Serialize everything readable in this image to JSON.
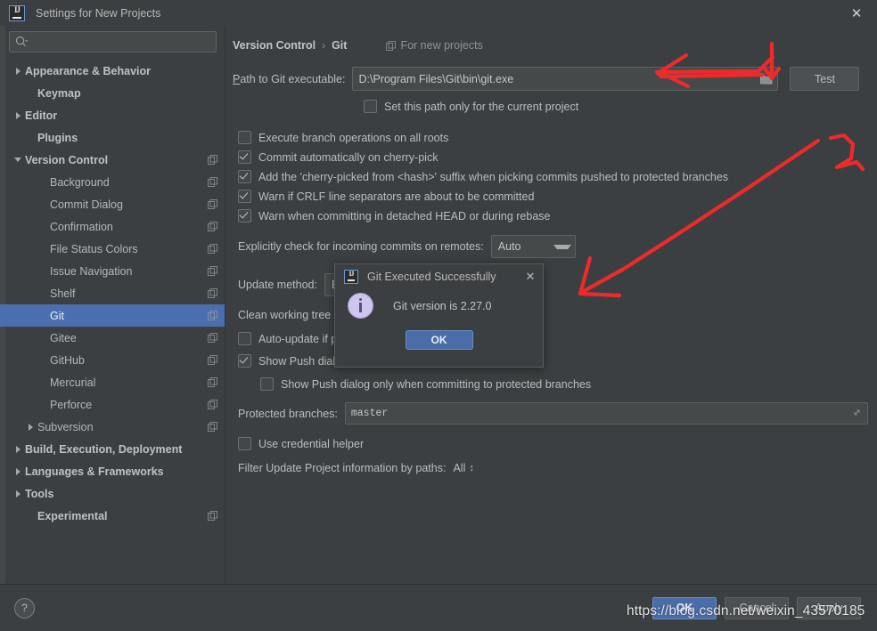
{
  "window": {
    "title": "Settings for New Projects",
    "close_label": "✕",
    "logo_name": "intellij-idea-logo"
  },
  "sidebar": {
    "search": {
      "value": "",
      "placeholder": ""
    },
    "items": [
      {
        "label": "Appearance & Behavior",
        "indent": 0,
        "twisty": "right",
        "bold": true,
        "copy": false,
        "selected": false
      },
      {
        "label": "Keymap",
        "indent": 1,
        "twisty": "none",
        "bold": true,
        "copy": false,
        "selected": false
      },
      {
        "label": "Editor",
        "indent": 0,
        "twisty": "right",
        "bold": true,
        "copy": false,
        "selected": false
      },
      {
        "label": "Plugins",
        "indent": 1,
        "twisty": "none",
        "bold": true,
        "copy": false,
        "selected": false
      },
      {
        "label": "Version Control",
        "indent": 0,
        "twisty": "down",
        "bold": true,
        "copy": true,
        "selected": false
      },
      {
        "label": "Background",
        "indent": 2,
        "twisty": "none",
        "bold": false,
        "copy": true,
        "selected": false
      },
      {
        "label": "Commit Dialog",
        "indent": 2,
        "twisty": "none",
        "bold": false,
        "copy": true,
        "selected": false
      },
      {
        "label": "Confirmation",
        "indent": 2,
        "twisty": "none",
        "bold": false,
        "copy": true,
        "selected": false
      },
      {
        "label": "File Status Colors",
        "indent": 2,
        "twisty": "none",
        "bold": false,
        "copy": true,
        "selected": false
      },
      {
        "label": "Issue Navigation",
        "indent": 2,
        "twisty": "none",
        "bold": false,
        "copy": true,
        "selected": false
      },
      {
        "label": "Shelf",
        "indent": 2,
        "twisty": "none",
        "bold": false,
        "copy": true,
        "selected": false
      },
      {
        "label": "Git",
        "indent": 2,
        "twisty": "none",
        "bold": false,
        "copy": true,
        "selected": true
      },
      {
        "label": "Gitee",
        "indent": 2,
        "twisty": "none",
        "bold": false,
        "copy": true,
        "selected": false
      },
      {
        "label": "GitHub",
        "indent": 2,
        "twisty": "none",
        "bold": false,
        "copy": true,
        "selected": false
      },
      {
        "label": "Mercurial",
        "indent": 2,
        "twisty": "none",
        "bold": false,
        "copy": true,
        "selected": false
      },
      {
        "label": "Perforce",
        "indent": 2,
        "twisty": "none",
        "bold": false,
        "copy": true,
        "selected": false
      },
      {
        "label": "Subversion",
        "indent": 1,
        "twisty": "right",
        "bold": false,
        "copy": true,
        "selected": false
      },
      {
        "label": "Build, Execution, Deployment",
        "indent": 0,
        "twisty": "right",
        "bold": true,
        "copy": false,
        "selected": false
      },
      {
        "label": "Languages & Frameworks",
        "indent": 0,
        "twisty": "right",
        "bold": true,
        "copy": false,
        "selected": false
      },
      {
        "label": "Tools",
        "indent": 0,
        "twisty": "right",
        "bold": true,
        "copy": false,
        "selected": false
      },
      {
        "label": "Experimental",
        "indent": 1,
        "twisty": "none",
        "bold": true,
        "copy": true,
        "selected": false
      }
    ]
  },
  "main": {
    "breadcrumb": {
      "parent": "Version Control",
      "separator": "›",
      "current": "Git"
    },
    "for_new_projects": "For new projects",
    "path_row": {
      "label": "Path to Git executable:",
      "value": "D:\\Program Files\\Git\\bin\\git.exe",
      "browse_icon": "folder-open-icon",
      "test_button": "Test"
    },
    "set_path_current_project": {
      "label": "Set this path only for the current project",
      "checked": false
    },
    "options": [
      {
        "label": "Execute branch operations on all roots",
        "checked": false
      },
      {
        "label": "Commit automatically on cherry-pick",
        "checked": true
      },
      {
        "label": "Add the 'cherry-picked from <hash>' suffix when picking commits pushed to protected branches",
        "checked": true
      },
      {
        "label": "Warn if CRLF line separators are about to be committed",
        "checked": true
      },
      {
        "label": "Warn when committing in detached HEAD or during rebase",
        "checked": true
      }
    ],
    "incoming_commits": {
      "label": "Explicitly check for incoming commits on remotes:",
      "value": "Auto"
    },
    "update_method": {
      "label": "Update method:",
      "value": "B"
    },
    "clean_working_tree": {
      "label": "Clean working tree"
    },
    "auto_update": {
      "label": "Auto-update if p",
      "checked": false
    },
    "show_push_dialog": {
      "label": "Show Push dialo",
      "checked": true
    },
    "show_push_protected": {
      "label": "Show Push dialog only when committing to protected branches",
      "checked": false
    },
    "protected_branches": {
      "label": "Protected branches:",
      "value": "master",
      "expand_icon": "expand-icon"
    },
    "use_credential_helper": {
      "label": "Use credential helper",
      "checked": false
    },
    "filter_update": {
      "label": "Filter Update Project information by paths:",
      "value": "All"
    }
  },
  "dialog": {
    "title": "Git Executed Successfully",
    "close_label": "✕",
    "message": "Git version is 2.27.0",
    "ok_label": "OK",
    "icon": "info-icon"
  },
  "footer": {
    "help_label": "?",
    "buttons": [
      {
        "label": "OK",
        "primary": true
      },
      {
        "label": "Cancel",
        "primary": false
      },
      {
        "label": "Apply",
        "primary": false
      }
    ]
  },
  "watermark": {
    "text": "https://blog.csdn.net/weixin_43570185"
  },
  "annotation": {
    "color": "#ef2a2a",
    "marks": [
      "left-arrow-to-path-field",
      "down-arrow-to-browse-button",
      "number-two-stroke",
      "long-diagonal-arrow"
    ]
  }
}
